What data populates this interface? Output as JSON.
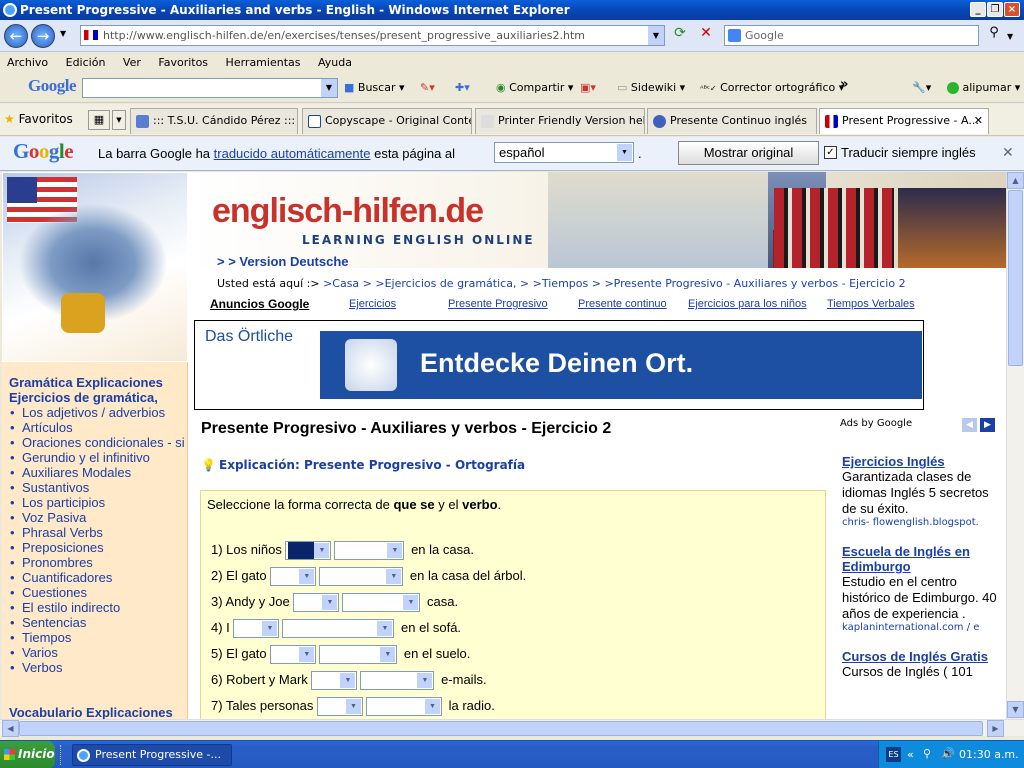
{
  "window": {
    "title": "Present Progressive - Auxiliaries and verbs - English - Windows Internet Explorer"
  },
  "address": {
    "url": "http://www.englisch-hilfen.de/en/exercises/tenses/present_progressive_auxiliaries2.htm",
    "search_placeholder": "Google"
  },
  "menu": [
    "Archivo",
    "Edición",
    "Ver",
    "Favoritos",
    "Herramientas",
    "Ayuda"
  ],
  "google_toolbar": {
    "logo": "Google",
    "buscar": "Buscar",
    "compartir": "Compartir",
    "sidewiki": "Sidewiki",
    "corrector": "Corrector ortográfico",
    "user": "alipumar"
  },
  "favorites": {
    "label": "Favoritos",
    "tabs": [
      "::: T.S.U. Cándido Pérez :::",
      "Copyscape - Original Conte...",
      "Printer Friendly Version hel...",
      "Presente Continuo inglés",
      "Present Progressive - A..."
    ]
  },
  "translate_bar": {
    "logo": "Google",
    "text1": "La barra Google ha",
    "link": "traducido automáticamente",
    "text2": "esta página al",
    "language": "español",
    "show_original": "Mostrar original",
    "always": "Traducir siempre inglés"
  },
  "site": {
    "name": "englisch-hilfen.de",
    "tagline": "LEARNING ENGLISH ONLINE",
    "version_link": "> > Version Deutsche"
  },
  "breadcrumb": {
    "prefix": "Usted está aquí :>",
    "items": [
      ">Casa >",
      ">Ejercicios de gramática, >",
      ">Tiempos >",
      ">Presente Progresivo - Auxiliares y verbos - Ejercicio 2"
    ]
  },
  "toplinks": {
    "ads": "Anuncios Google",
    "items": [
      "Ejercicios",
      "Presente Progresivo",
      "Presente continuo",
      "Ejercicios para los niños",
      "Tiempos Verbales"
    ]
  },
  "ad_banner": {
    "brand": "Das Örtliche",
    "slogan": "Entdecke Deinen Ort."
  },
  "sidebar": {
    "heading1": "Gramática Explicaciones",
    "heading2": "Ejercicios de gramática,",
    "items": [
      "Los adjetivos / adverbios",
      "Artículos",
      "Oraciones condicionales - si",
      "Gerundio y el infinitivo",
      "Auxiliares Modales",
      "Sustantivos",
      "Los participios",
      "Voz Pasiva",
      "Phrasal Verbs",
      "Preposiciones",
      "Pronombres",
      "Cuantificadores",
      "Cuestiones",
      "El estilo indirecto",
      "Sentencias",
      "Tiempos",
      "Varios",
      "Verbos"
    ],
    "heading3": "Vocabulario Explicaciones"
  },
  "main": {
    "title": "Presente Progresivo - Auxiliares y verbos - Ejercicio 2",
    "explanation_label": "Explicación:",
    "explanation_link1": "Presente Progresivo",
    "explanation_link2": "Ortografía",
    "instruction_a": "Seleccione la forma correcta de",
    "instruction_b": "que se",
    "instruction_c": "y el",
    "instruction_d": "verbo",
    "instruction_e": ".",
    "questions": [
      {
        "pre": "1) Los niños",
        "post": "en la casa."
      },
      {
        "pre": "2) El gato",
        "post": "en la casa del árbol."
      },
      {
        "pre": "3) Andy y Joe",
        "post": "casa."
      },
      {
        "pre": "4) I",
        "post": "en el sofá."
      },
      {
        "pre": "5) El gato",
        "post": "en el suelo."
      },
      {
        "pre": "6) Robert y Mark",
        "post": "e-mails."
      },
      {
        "pre": "7) Tales personas",
        "post": "la radio."
      }
    ]
  },
  "ads_right": {
    "label": "Ads by Google",
    "items": [
      {
        "title": "Ejercicios Inglés",
        "text": "Garantizada clases de idiomas Inglés 5 secretos de su éxito.",
        "url": "chris- flowenglish.blogspot."
      },
      {
        "title": "Escuela de Inglés en Edimburgo",
        "text": "Estudio en el centro histórico de Edimburgo. 40 años de experiencia .",
        "url": "kaplaninternational.com / e"
      },
      {
        "title": "Cursos de Inglés Gratis",
        "text": "Cursos de Inglés ( 101",
        "url": ""
      }
    ]
  },
  "taskbar": {
    "start": "Inicio",
    "task": "Present Progressive -...",
    "lang": "ES",
    "time": "01:30 a.m."
  }
}
